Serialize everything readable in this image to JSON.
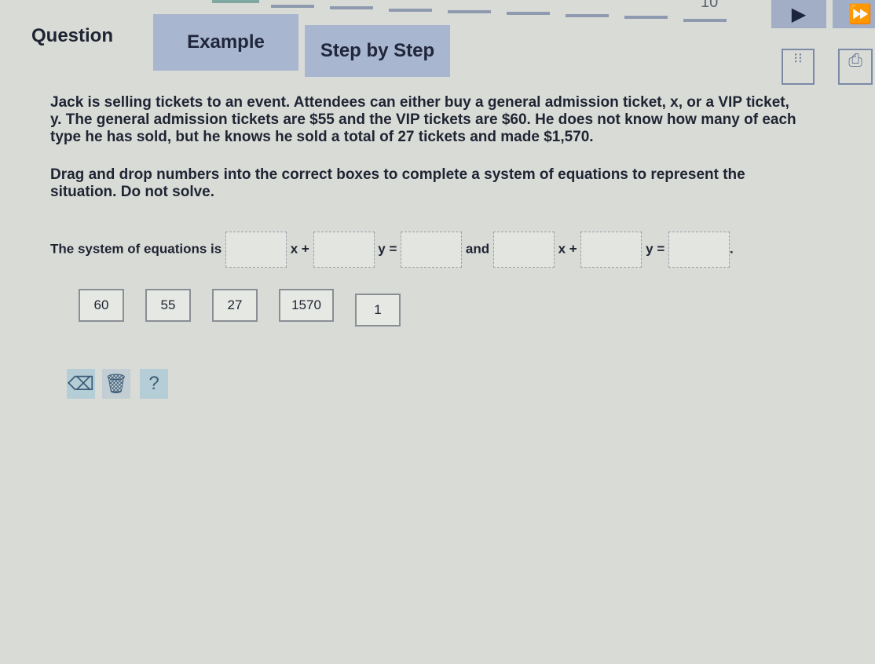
{
  "progress": {
    "last_step_label": "10"
  },
  "tabs": {
    "question": "Question",
    "example": "Example",
    "step_by_step": "Step by Step"
  },
  "icons": {
    "prev": "play-icon",
    "next": "fast-forward-icon",
    "book": "book-icon",
    "print": "printer-icon"
  },
  "problem": "Jack is selling tickets to an event. Attendees can either buy a general admission ticket, x, or a VIP ticket, y. The general admission tickets are $55 and the VIP tickets are $60. He does not know how many of each type he has sold, but he knows he sold a total of 27 tickets and made $1,570.",
  "instruction": "Drag and drop numbers into the correct boxes to complete a system of equations to represent the situation. Do not solve.",
  "equation": {
    "lead": "The system of equations is",
    "x": "x +",
    "y": "y =",
    "and": "and",
    "end": "."
  },
  "tiles": [
    "60",
    "55",
    "27",
    "1570",
    "1"
  ],
  "tools": {
    "help": "?"
  }
}
